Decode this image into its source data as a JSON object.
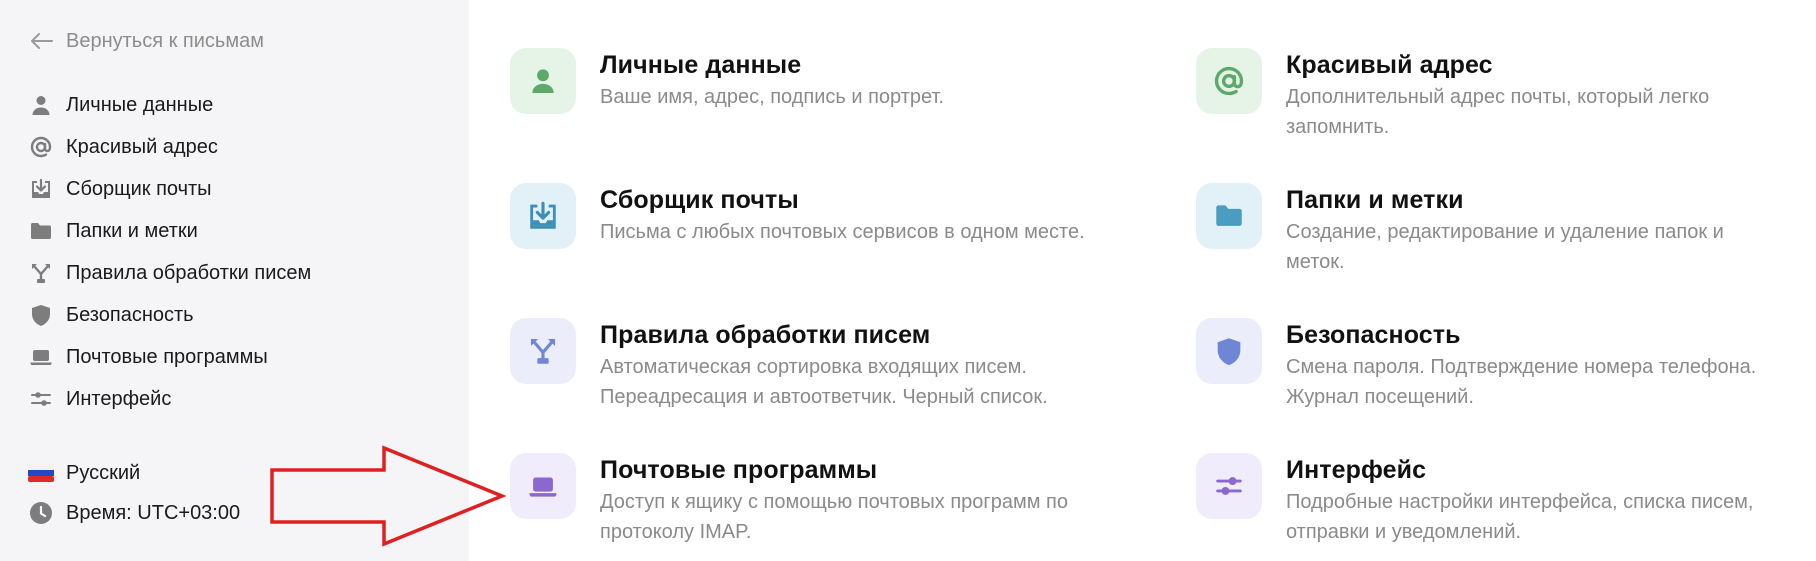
{
  "sidebar": {
    "back_label": "Вернуться к письмам",
    "items": [
      {
        "label": "Личные данные",
        "icon": "person-icon"
      },
      {
        "label": "Красивый адрес",
        "icon": "at-icon"
      },
      {
        "label": "Сборщик почты",
        "icon": "inbox-download-icon"
      },
      {
        "label": "Папки и метки",
        "icon": "folder-icon"
      },
      {
        "label": "Правила обработки писем",
        "icon": "fork-icon"
      },
      {
        "label": "Безопасность",
        "icon": "shield-icon"
      },
      {
        "label": "Почтовые программы",
        "icon": "laptop-icon"
      },
      {
        "label": "Интерфейс",
        "icon": "sliders-icon"
      }
    ],
    "language": "Русский",
    "time": "Время: UTC+03:00"
  },
  "cards": [
    {
      "title": "Личные данные",
      "desc": "Ваше имя, адрес, подпись и портрет.",
      "icon": "person-icon",
      "tile_color": "#e6f4e8",
      "icon_color": "#5caa6a"
    },
    {
      "title": "Красивый адрес",
      "desc": "Дополнительный адрес почты, который легко запомнить.",
      "icon": "at-icon",
      "tile_color": "#e6f4e8",
      "icon_color": "#5caa6a"
    },
    {
      "title": "Сборщик почты",
      "desc": "Письма с любых почтовых сервисов в одном месте.",
      "icon": "inbox-download-icon",
      "tile_color": "#e2f1f7",
      "icon_color": "#3d8fb5"
    },
    {
      "title": "Папки и метки",
      "desc": "Создание, редактирование и удаление папок и меток.",
      "icon": "folder-icon",
      "tile_color": "#e2f1f7",
      "icon_color": "#4a9cc0"
    },
    {
      "title": "Правила обработки писем",
      "desc": "Автоматическая сортировка входящих писем. Переадресация и автоответчик. Черный список.",
      "icon": "fork-icon",
      "tile_color": "#ebeefa",
      "icon_color": "#6f86d6"
    },
    {
      "title": "Безопасность",
      "desc": "Смена пароля. Подтверждение номера телефона. Журнал посещений.",
      "icon": "shield-icon",
      "tile_color": "#ebeefa",
      "icon_color": "#6f86d6"
    },
    {
      "title": "Почтовые программы",
      "desc": "Доступ к ящику с помощью почтовых программ по протоколу IMAP.",
      "icon": "laptop-icon",
      "tile_color": "#f1ecfb",
      "icon_color": "#8a68d0"
    },
    {
      "title": "Интерфейс",
      "desc": "Подробные настройки интерфейса, списка писем, отправки и уведомлений.",
      "icon": "sliders-icon",
      "tile_color": "#f1ecfb",
      "icon_color": "#8a68d0"
    }
  ],
  "annotation": {
    "arrow_color": "#e02020",
    "icon": "red-arrow-annotation"
  }
}
